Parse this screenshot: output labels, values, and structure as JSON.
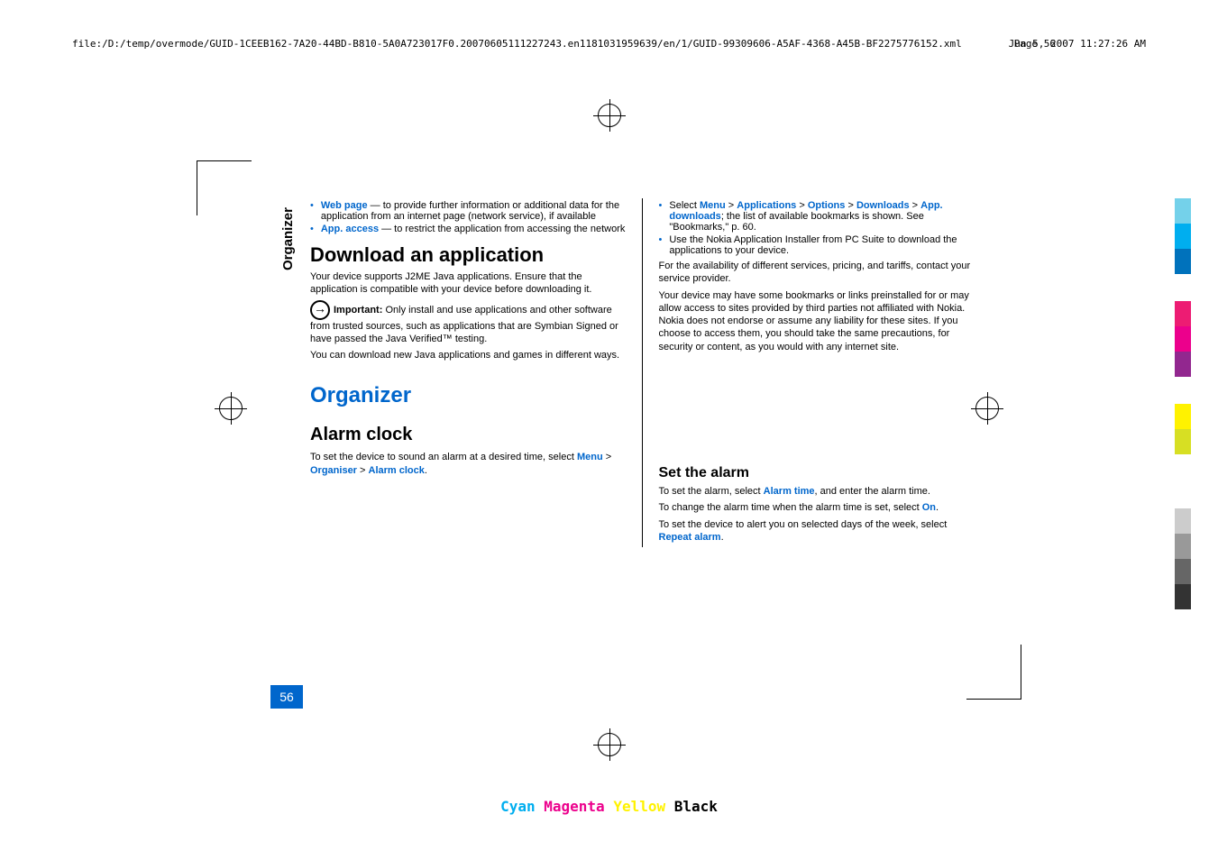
{
  "header": {
    "path": "file:/D:/temp/overmode/GUID-1CEEB162-7A20-44BD-B810-5A0A723017F0.20070605111227243.en1181031959639/en/1/GUID-99309606-A5AF-4368-A45B-BF2275776152.xml",
    "page": "Page  56",
    "date": "Jun 5, 2007 11:27:26 AM"
  },
  "sidebar": "Organizer",
  "pagenum": "56",
  "col1": {
    "b1": {
      "link": "Web page",
      "text": " —  to provide further information or additional data for the application from an internet page (network service), if available"
    },
    "b2": {
      "link": "App. access",
      "text": " —  to restrict the application from accessing the network"
    },
    "h1": "Download an application",
    "p1": "Your device supports J2ME Java applications. Ensure that the application is compatible with your device before downloading it.",
    "important": {
      "label": "Important:",
      "text": "  Only install and use applications and other software from trusted sources, such as applications that are Symbian Signed or have passed the Java Verified™ testing."
    },
    "p2": "You can download new Java applications and games in different ways.",
    "h2": "Organizer",
    "h3": "Alarm clock",
    "p3a": "To set the device to sound an alarm at a desired time, select ",
    "p3_menu": "Menu",
    "p3_sep": " > ",
    "p3_org": "Organiser",
    "p3_clock": "Alarm clock",
    "p3_end": "."
  },
  "col2": {
    "b1a": "Select ",
    "b1_menu": "Menu",
    "b1_sep": " > ",
    "b1_apps": "Applications",
    "b1_opts": "Options",
    "b1_dl": "Downloads",
    "b1_appdl": "App. downloads",
    "b1b": "; the list of available bookmarks is shown. See \"Bookmarks,\" p. 60.",
    "b2": "Use the Nokia Application Installer from PC Suite to download the applications to your device.",
    "p1": "For the availability of different services, pricing, and tariffs, contact your service provider.",
    "p2": "Your device may have some bookmarks or links preinstalled for or may allow access to sites provided by third parties not affiliated with Nokia. Nokia does not endorse or assume any liability for these sites. If you choose to access them, you should take the same precautions, for security or content, as you would with any internet site.",
    "h3": "Set the alarm",
    "p3a": "To set the alarm, select ",
    "p3_link": "Alarm time",
    "p3b": ", and enter the alarm time.",
    "p4a": "To change the alarm time when the alarm time is set, select ",
    "p4_link": "On",
    "p4b": ".",
    "p5a": "To set the device to alert you on selected days of the week, select ",
    "p5_link": "Repeat alarm",
    "p5b": "."
  },
  "cmyk": {
    "c": "Cyan",
    "m": "Magenta",
    "y": "Yellow",
    "k": "Black"
  },
  "colors": [
    "#74d1ea",
    "#00aeef",
    "#0072bc",
    "#ed1c73",
    "#ec008c",
    "#fff200",
    "#d7df23",
    "#999",
    "#666",
    "#333"
  ]
}
